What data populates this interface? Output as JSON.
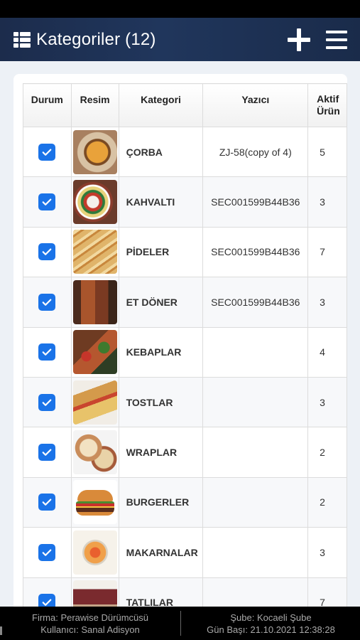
{
  "header": {
    "title": "Kategoriler (12)",
    "icons": {
      "menu": "list-icon",
      "add": "plus-icon",
      "more": "hamburger-icon"
    }
  },
  "table": {
    "columns": [
      "Durum",
      "Resim",
      "Kategori",
      "Yazıcı",
      "Aktif Ürün"
    ],
    "aktif_header_line1": "Aktif",
    "aktif_header_line2": "Ürün",
    "rows": [
      {
        "checked": true,
        "image": "soup-image",
        "kategori": "ÇORBA",
        "yazici": "ZJ-58(copy of 4)",
        "aktif": "5"
      },
      {
        "checked": true,
        "image": "breakfast-image",
        "kategori": "KAHVALTI",
        "yazici": "SEC001599B44B36",
        "aktif": "3"
      },
      {
        "checked": true,
        "image": "pide-image",
        "kategori": "PİDELER",
        "yazici": "SEC001599B44B36",
        "aktif": "7"
      },
      {
        "checked": true,
        "image": "doner-image",
        "kategori": "ET DÖNER",
        "yazici": "SEC001599B44B36",
        "aktif": "3"
      },
      {
        "checked": true,
        "image": "kebab-image",
        "kategori": "KEBAPLAR",
        "yazici": "",
        "aktif": "4"
      },
      {
        "checked": true,
        "image": "toast-image",
        "kategori": "TOSTLAR",
        "yazici": "",
        "aktif": "3"
      },
      {
        "checked": true,
        "image": "wrap-image",
        "kategori": "WRAPLAR",
        "yazici": "",
        "aktif": "2"
      },
      {
        "checked": true,
        "image": "burger-image",
        "kategori": "BURGERLER",
        "yazici": "",
        "aktif": "2"
      },
      {
        "checked": true,
        "image": "pasta-image",
        "kategori": "MAKARNALAR",
        "yazici": "",
        "aktif": "3"
      },
      {
        "checked": true,
        "image": "dessert-image",
        "kategori": "TATLILAR",
        "yazici": "",
        "aktif": "7"
      }
    ]
  },
  "footer": {
    "firma": "Firma: Perawise Dürümcüsü",
    "kullanici": "Kullanıcı: Sanal Adisyon",
    "sube": "Şube: Kocaeli Şube",
    "gun_basi": "Gün Başı: 21.10.2021 12:38:28"
  },
  "colors": {
    "header_bg": "#1f3356",
    "checkbox": "#1a73e8",
    "content_bg": "#edf1f6"
  }
}
